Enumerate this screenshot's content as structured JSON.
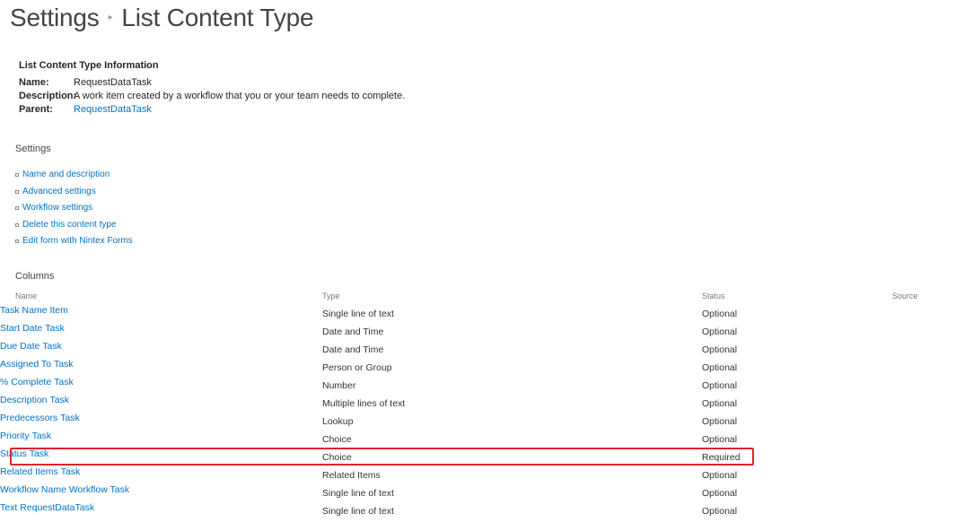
{
  "page": {
    "title": "Settings",
    "subtitle": "List Content Type",
    "separator": "▸"
  },
  "info": {
    "heading": "List Content Type Information",
    "name_label": "Name:",
    "name_value": "RequestDataTask",
    "description_label": "Description:",
    "description_value": "A work item created by a workflow that you or your team needs to complete.",
    "parent_label": "Parent:",
    "parent_value": "RequestDataTask"
  },
  "settings": {
    "title": "Settings",
    "links": [
      "Name and description",
      "Advanced settings",
      "Workflow settings",
      "Delete this content type",
      "Edit form with Nintex Forms"
    ]
  },
  "columns": {
    "title": "Columns",
    "headers": {
      "name": "Name",
      "type": "Type",
      "status": "Status",
      "source": "Source"
    },
    "rows": [
      {
        "name": "Task Name",
        "type": "Single line of text",
        "status": "Optional",
        "source": "Item"
      },
      {
        "name": "Start Date",
        "type": "Date and Time",
        "status": "Optional",
        "source": "Task"
      },
      {
        "name": "Due Date",
        "type": "Date and Time",
        "status": "Optional",
        "source": "Task"
      },
      {
        "name": "Assigned To",
        "type": "Person or Group",
        "status": "Optional",
        "source": "Task"
      },
      {
        "name": "% Complete",
        "type": "Number",
        "status": "Optional",
        "source": "Task"
      },
      {
        "name": "Description",
        "type": "Multiple lines of text",
        "status": "Optional",
        "source": "Task"
      },
      {
        "name": "Predecessors",
        "type": "Lookup",
        "status": "Optional",
        "source": "Task"
      },
      {
        "name": "Priority",
        "type": "Choice",
        "status": "Optional",
        "source": "Task"
      },
      {
        "name": "Status",
        "type": "Choice",
        "status": "Required",
        "source": "Task"
      },
      {
        "name": "Related Items",
        "type": "Related Items",
        "status": "Optional",
        "source": "Task"
      },
      {
        "name": "Workflow Name",
        "type": "Single line of text",
        "status": "Optional",
        "source": "Workflow Task"
      },
      {
        "name": "Text",
        "type": "Single line of text",
        "status": "Optional",
        "source": "RequestDataTask"
      }
    ]
  },
  "colors": {
    "link": "#0072c6",
    "text": "#444444",
    "highlight_border": "#d9262f"
  }
}
